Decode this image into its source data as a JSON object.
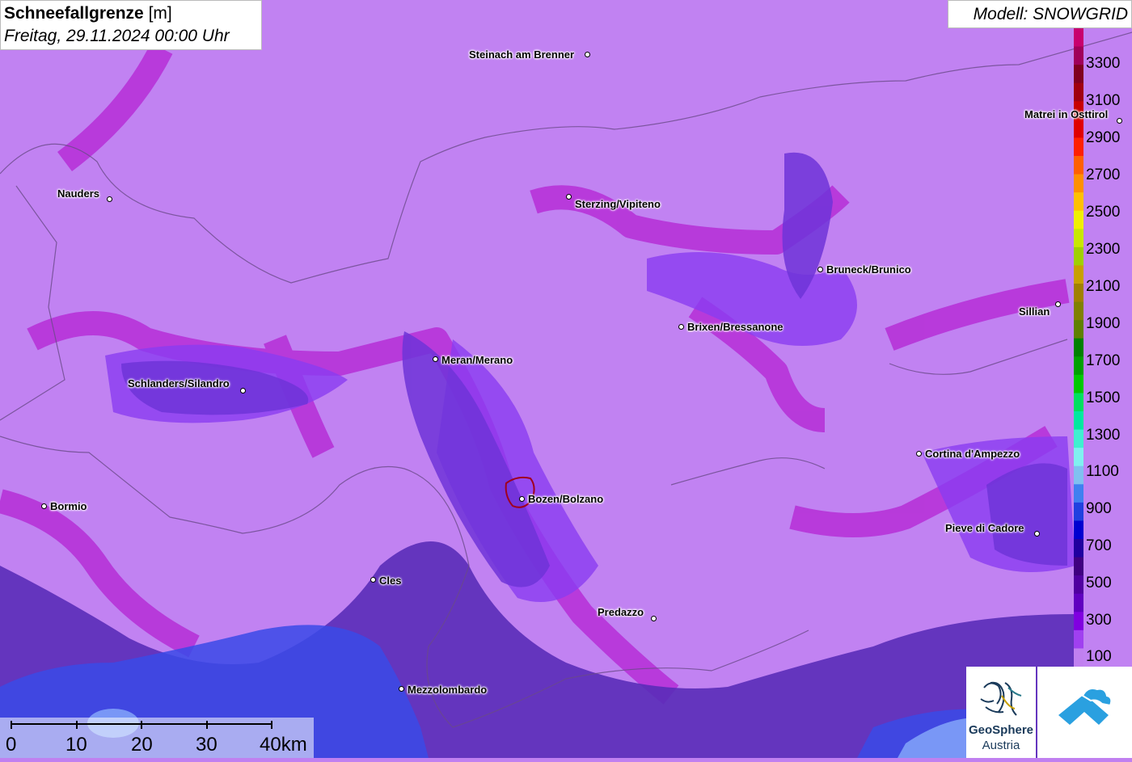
{
  "title": {
    "main": "Schneefallgrenze",
    "unit": "[m]",
    "datetime": "Freitag, 29.11.2024 00:00 Uhr"
  },
  "model": {
    "label": "Modell: SNOWGRID"
  },
  "legend": {
    "labels": [
      "3300",
      "3100",
      "2900",
      "2700",
      "2500",
      "2300",
      "2100",
      "1900",
      "1700",
      "1500",
      "1300",
      "1100",
      "900",
      "700",
      "500",
      "300",
      "100"
    ],
    "colors": [
      "#c8006e",
      "#a0005a",
      "#800020",
      "#a00010",
      "#c80000",
      "#e00000",
      "#ff2000",
      "#ff6000",
      "#ff9000",
      "#ffc000",
      "#f0f000",
      "#c8e800",
      "#a0d000",
      "#c8a000",
      "#a08000",
      "#808000",
      "#608000",
      "#008000",
      "#00a000",
      "#00c800",
      "#00e060",
      "#00e8a0",
      "#40f0d0",
      "#80f0f0",
      "#80c0f0",
      "#4080f0",
      "#2040e0",
      "#0000d0",
      "#2000a0",
      "#400080",
      "#5000a0",
      "#6000c0",
      "#8000e0",
      "#a040f0",
      "#c080f0"
    ]
  },
  "cities": [
    {
      "name": "Steinach am Brenner",
      "icon": "city-dot"
    },
    {
      "name": "Matrei in Osttirol",
      "icon": "city-dot"
    },
    {
      "name": "Nauders",
      "icon": "city-dot"
    },
    {
      "name": "Sterzing/Vipiteno",
      "icon": "city-dot"
    },
    {
      "name": "Bruneck/Brunico",
      "icon": "city-dot"
    },
    {
      "name": "Sillian",
      "icon": "city-dot"
    },
    {
      "name": "Brixen/Bressanone",
      "icon": "city-dot"
    },
    {
      "name": "Meran/Merano",
      "icon": "city-dot"
    },
    {
      "name": "Schlanders/Silandro",
      "icon": "city-dot"
    },
    {
      "name": "Cortina d'Ampezzo",
      "icon": "city-dot"
    },
    {
      "name": "Bormio",
      "icon": "city-dot"
    },
    {
      "name": "Bozen/Bolzano",
      "icon": "city-dot"
    },
    {
      "name": "Pieve di Cadore",
      "icon": "city-dot"
    },
    {
      "name": "Cles",
      "icon": "city-dot"
    },
    {
      "name": "Predazzo",
      "icon": "city-dot"
    },
    {
      "name": "Mezzolombardo",
      "icon": "city-dot"
    }
  ],
  "scale": {
    "labels": [
      "0",
      "10",
      "20",
      "30",
      "40km"
    ]
  },
  "logos": {
    "geosphere_line1": "GeoSphere",
    "geosphere_line2": "Austria",
    "icon": "cloud-arrow-icon"
  }
}
